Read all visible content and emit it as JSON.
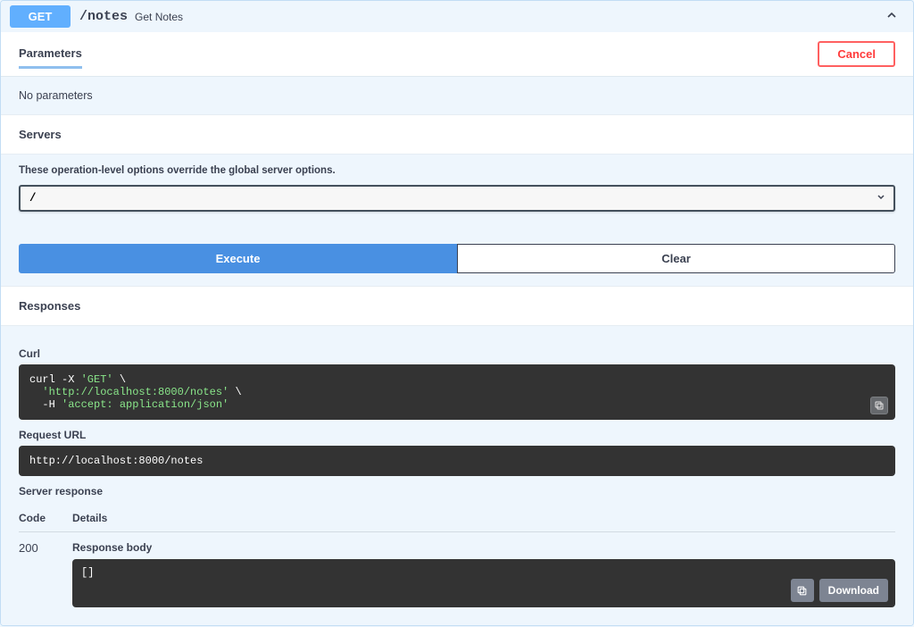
{
  "operation": {
    "method": "GET",
    "path": "/notes",
    "summary": "Get Notes"
  },
  "parameters": {
    "heading": "Parameters",
    "cancel_label": "Cancel",
    "empty_text": "No parameters"
  },
  "servers": {
    "heading": "Servers",
    "note": "These operation-level options override the global server options.",
    "selected": "/"
  },
  "buttons": {
    "execute": "Execute",
    "clear": "Clear"
  },
  "responses": {
    "heading": "Responses",
    "curl_title": "Curl",
    "curl_line1a": "curl -X ",
    "curl_line1b": "'GET'",
    "curl_line1c": " \\",
    "curl_line2": "  'http://localhost:8000/notes'",
    "curl_line2b": " \\",
    "curl_line3a": "  -H ",
    "curl_line3b": "'accept: application/json'",
    "request_url_title": "Request URL",
    "request_url": "http://localhost:8000/notes",
    "server_response_title": "Server response",
    "col_code": "Code",
    "col_details": "Details",
    "row_code": "200",
    "response_body_title": "Response body",
    "response_body": "[]",
    "download_label": "Download"
  }
}
